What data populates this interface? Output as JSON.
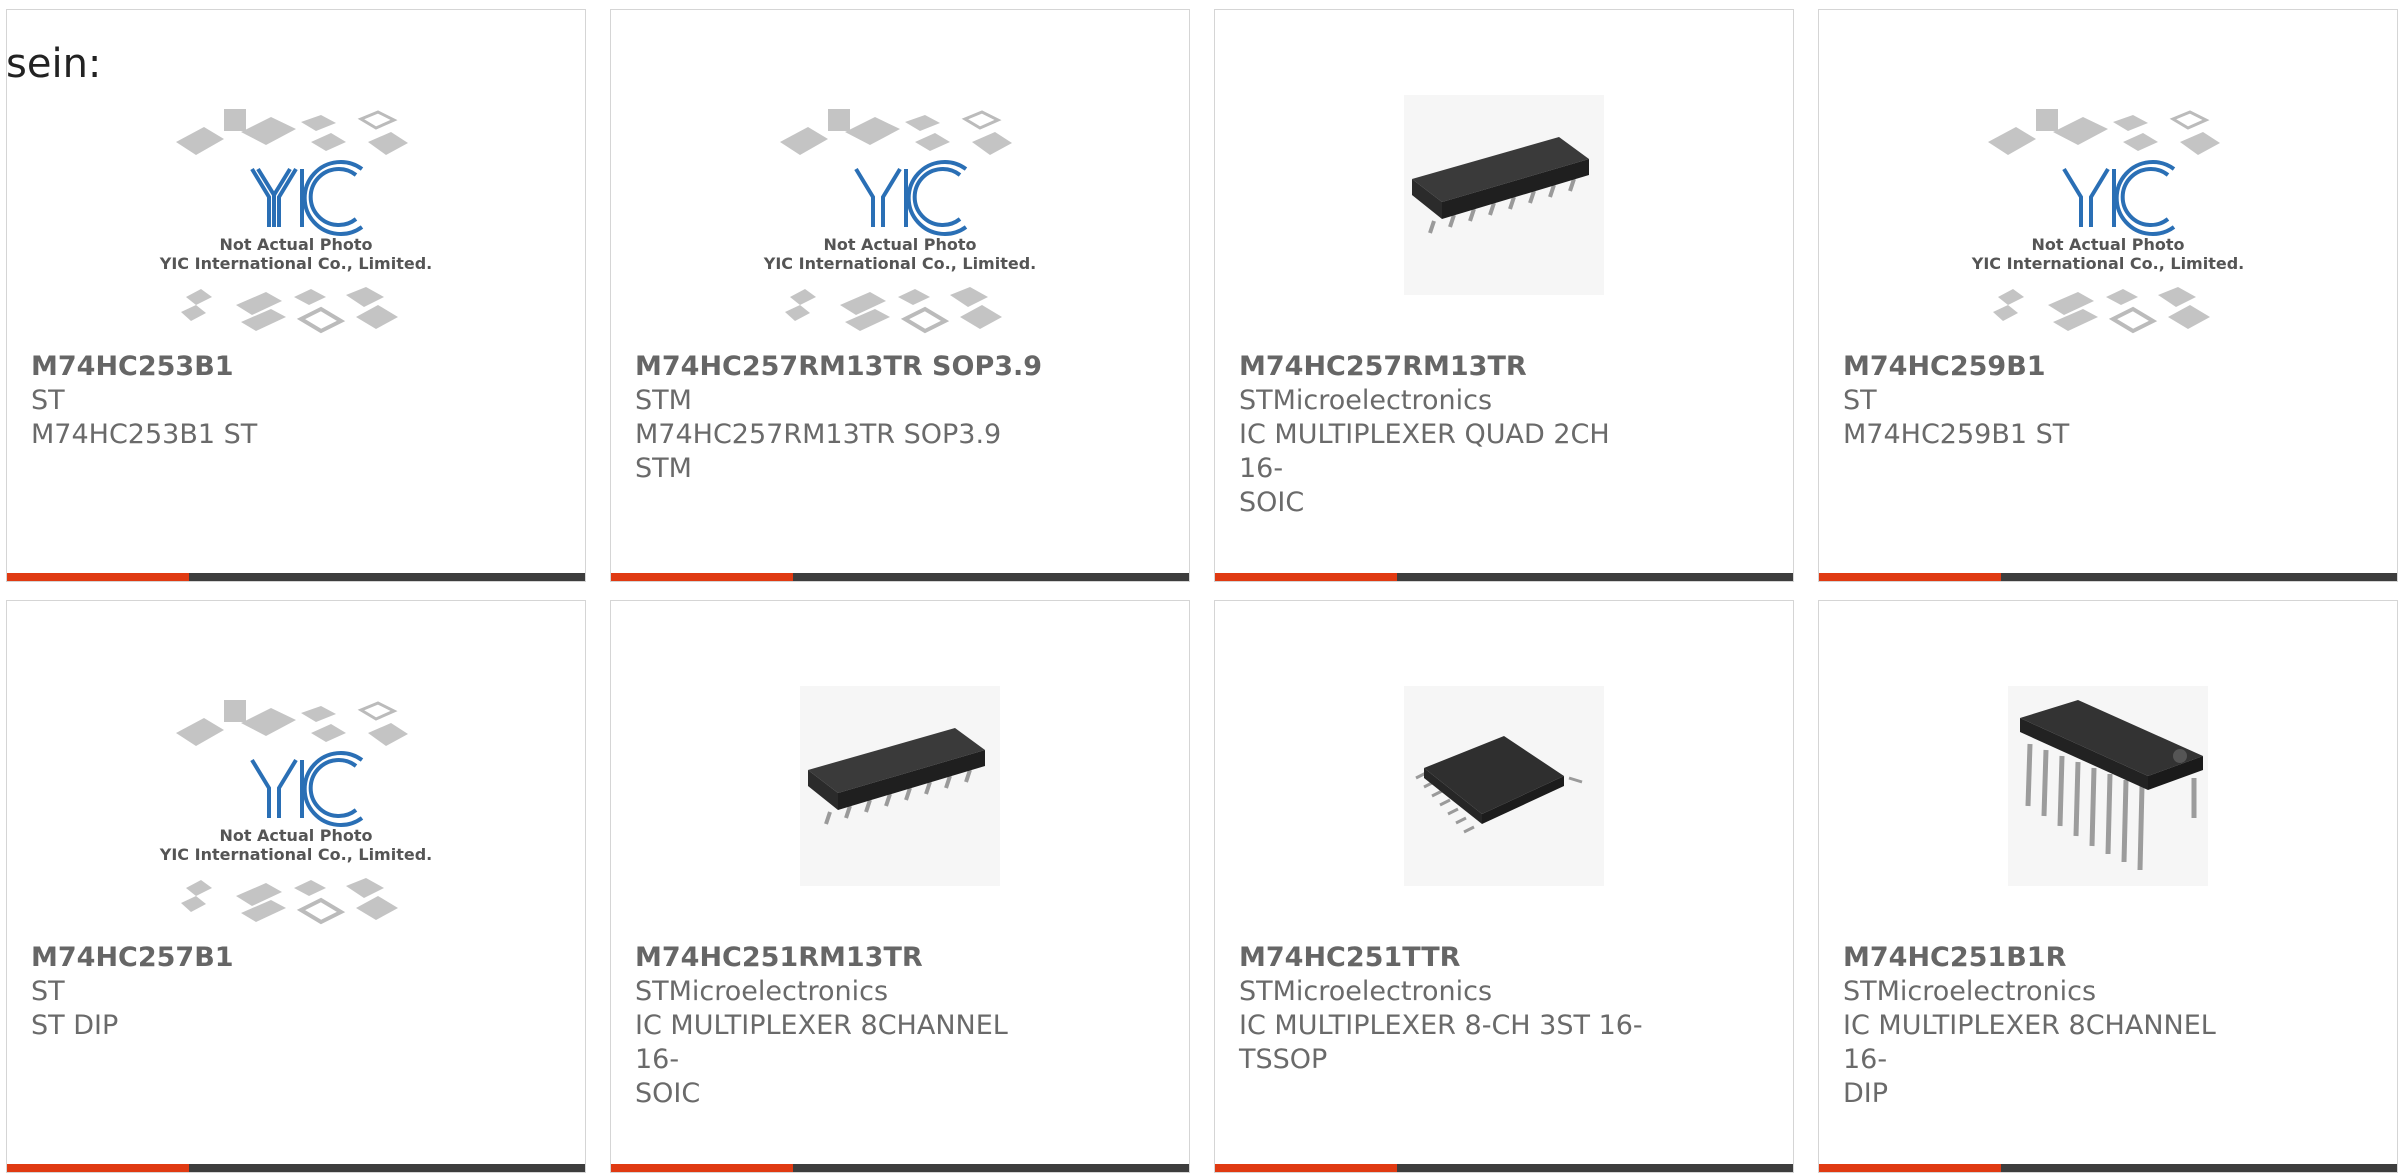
{
  "intro_text": "sein:",
  "placeholder": {
    "line1": "Not Actual Photo",
    "line2": "YIC International Co., Limited."
  },
  "colors": {
    "accent": "#e03a12",
    "bar": "#3d3d3d",
    "logo_blue": "#2a6fb5"
  },
  "products": [
    {
      "part": "M74HC253B1",
      "manufacturer": "ST",
      "desc1": "M74HC253B1 ST",
      "desc2": "",
      "image": "yic-placeholder"
    },
    {
      "part": "M74HC257RM13TR SOP3.9",
      "manufacturer": "STM",
      "desc1": "M74HC257RM13TR SOP3.9 STM",
      "desc2": "",
      "image": "yic-placeholder"
    },
    {
      "part": "M74HC257RM13TR",
      "manufacturer": "STMicroelectronics",
      "desc1": "IC MULTIPLEXER QUAD 2CH 16-",
      "desc2": "SOIC",
      "image": "soic-chip"
    },
    {
      "part": "M74HC259B1",
      "manufacturer": "ST",
      "desc1": "M74HC259B1 ST",
      "desc2": "",
      "image": "yic-placeholder"
    },
    {
      "part": "M74HC257B1",
      "manufacturer": "ST",
      "desc1": "ST DIP",
      "desc2": "",
      "image": "yic-placeholder"
    },
    {
      "part": "M74HC251RM13TR",
      "manufacturer": "STMicroelectronics",
      "desc1": "IC MULTIPLEXER 8CHANNEL 16-",
      "desc2": "SOIC",
      "image": "soic-chip"
    },
    {
      "part": "M74HC251TTR",
      "manufacturer": "STMicroelectronics",
      "desc1": "IC MULTIPLEXER 8-CH 3ST 16-",
      "desc2": "TSSOP",
      "image": "tssop-chip"
    },
    {
      "part": "M74HC251B1R",
      "manufacturer": "STMicroelectronics",
      "desc1": "IC MULTIPLEXER 8CHANNEL 16-",
      "desc2": "DIP",
      "image": "dip-chip"
    }
  ]
}
